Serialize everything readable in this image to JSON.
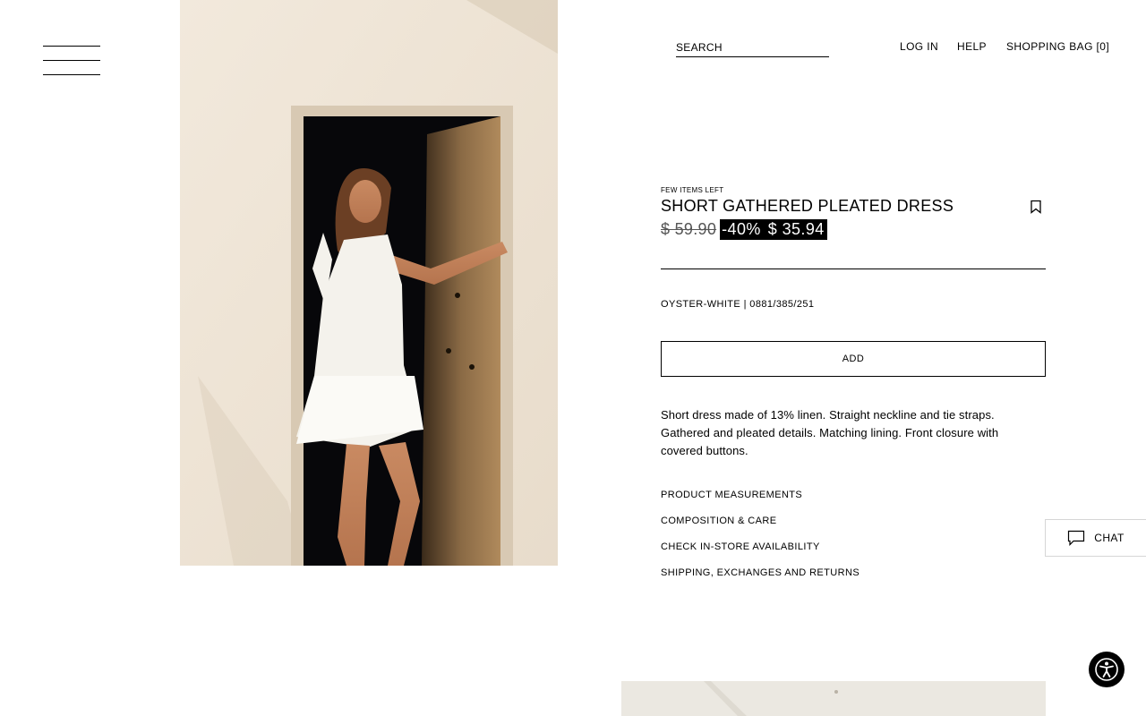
{
  "header": {
    "menu_icon": "hamburger-menu-icon",
    "search_placeholder": "SEARCH",
    "login_label": "LOG IN",
    "help_label": "HELP",
    "bag_label": "SHOPPING BAG [0]"
  },
  "product": {
    "stock_badge": "FEW ITEMS LEFT",
    "title": "SHORT GATHERED PLEATED DRESS",
    "bookmark_icon": "bookmark-icon",
    "original_price": "$ 59.90",
    "discount": "-40%",
    "sale_price": "$ 35.94",
    "color_ref": "OYSTER-WHITE | 0881/385/251",
    "add_label": "ADD",
    "description": "Short dress made of 13% linen. Straight neckline and tie straps. Gathered and pleated details. Matching lining. Front closure with covered buttons.",
    "info_links": [
      "PRODUCT MEASUREMENTS",
      "COMPOSITION & CARE",
      "CHECK IN-STORE AVAILABILITY",
      "SHIPPING, EXCHANGES AND RETURNS"
    ]
  },
  "chat": {
    "label": "CHAT",
    "icon": "chat-bubble-icon"
  },
  "accessibility": {
    "icon": "accessibility-icon"
  },
  "colors": {
    "text": "#000000",
    "background": "#ffffff",
    "sale_bg": "#000000",
    "sale_text": "#ffffff"
  }
}
